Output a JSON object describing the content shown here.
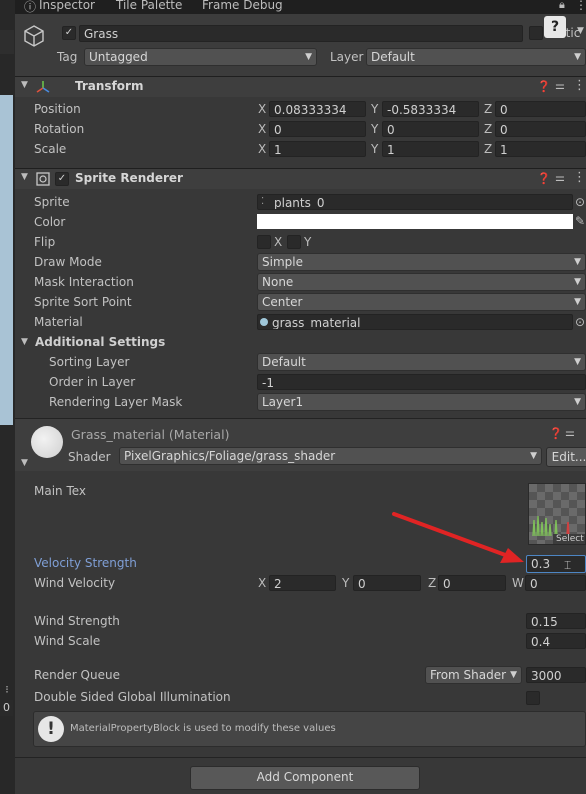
{
  "tabs": {
    "inspector": "Inspector",
    "tile_palette": "Tile Palette",
    "frame_debug": "Frame Debug"
  },
  "header": {
    "object_name": "Grass",
    "static_label": "Static",
    "tag_label": "Tag",
    "tag_value": "Untagged",
    "layer_label": "Layer",
    "layer_value": "Default"
  },
  "transform": {
    "title": "Transform",
    "rows": [
      {
        "label": "Position",
        "x": "0.08333334",
        "y": "-0.5833334",
        "z": "0"
      },
      {
        "label": "Rotation",
        "x": "0",
        "y": "0",
        "z": "0"
      },
      {
        "label": "Scale",
        "x": "1",
        "y": "1",
        "z": "1"
      }
    ],
    "axis_x": "X",
    "axis_y": "Y",
    "axis_z": "Z"
  },
  "sprite_renderer": {
    "title": "Sprite Renderer",
    "sprite_label": "Sprite",
    "sprite_value": "plants_0",
    "color_label": "Color",
    "flip_label": "Flip",
    "flip_x": "X",
    "flip_y": "Y",
    "draw_mode_label": "Draw Mode",
    "draw_mode_value": "Simple",
    "mask_label": "Mask Interaction",
    "mask_value": "None",
    "sort_point_label": "Sprite Sort Point",
    "sort_point_value": "Center",
    "material_label": "Material",
    "material_value": "grass_material",
    "additional_label": "Additional Settings",
    "sorting_layer_label": "Sorting Layer",
    "sorting_layer_value": "Default",
    "order_label": "Order in Layer",
    "order_value": "-1",
    "rendering_mask_label": "Rendering Layer Mask",
    "rendering_mask_value": "Layer1"
  },
  "material": {
    "title": "Grass_material (Material)",
    "shader_label": "Shader",
    "shader_value": "PixelGraphics/Foliage/grass_shader",
    "edit_label": "Edit...",
    "main_tex_label": "Main Tex",
    "select_label": "Select",
    "velocity_label": "Velocity Strength",
    "velocity_value": "0.3",
    "wind_velocity_label": "Wind Velocity",
    "wv_x": "2",
    "wv_y": "0",
    "wv_z": "0",
    "wv_w": "0",
    "axis_w": "W",
    "wind_strength_label": "Wind Strength",
    "wind_strength_value": "0.15",
    "wind_scale_label": "Wind Scale",
    "wind_scale_value": "0.4",
    "render_queue_label": "Render Queue",
    "render_queue_mode": "From Shader",
    "render_queue_value": "3000",
    "dsgi_label": "Double Sided Global Illumination",
    "info_text": "MaterialPropertyBlock is used to modify these values"
  },
  "add_component": "Add Component",
  "left_panel": {
    "zero": "0"
  },
  "colors": {
    "accent_label": "#7f9fd6",
    "arrow": "#e02424",
    "panel_bg": "#383838"
  }
}
